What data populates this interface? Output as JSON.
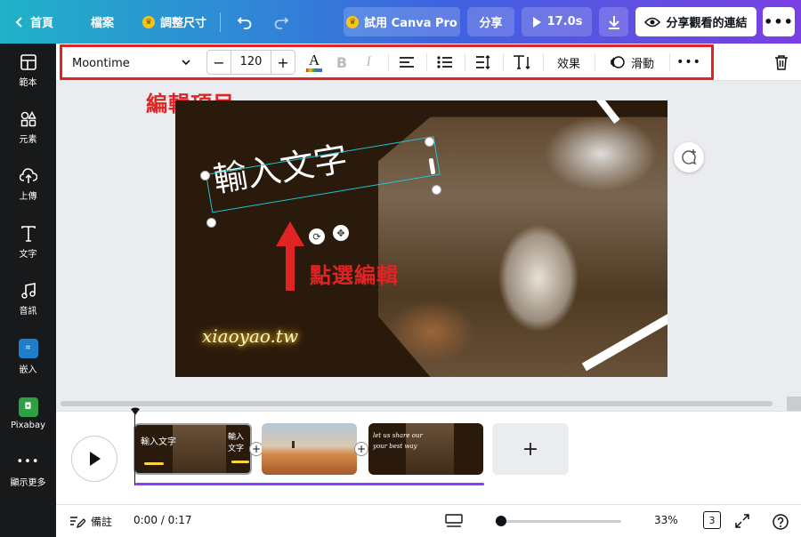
{
  "topbar": {
    "home_label": "首頁",
    "file_label": "檔案",
    "resize_label": "調整尺寸",
    "pro_label": "試用 Canva Pro",
    "share_label": "分享",
    "duration_label": "17.0s",
    "view_link_label": "分享觀看的連結",
    "gradient_start": "#1fb3c8",
    "gradient_end": "#7b3fe4"
  },
  "sidebar": {
    "items": [
      {
        "label": "範本",
        "icon": "template-icon"
      },
      {
        "label": "元素",
        "icon": "elements-icon"
      },
      {
        "label": "上傳",
        "icon": "upload-icon"
      },
      {
        "label": "文字",
        "icon": "text-icon"
      },
      {
        "label": "音訊",
        "icon": "music-icon"
      },
      {
        "label": "嵌入",
        "icon": "embed-icon"
      },
      {
        "label": "Pixabay",
        "icon": "pixabay-icon"
      },
      {
        "label": "顯示更多",
        "icon": "more-icon"
      }
    ]
  },
  "toolbar": {
    "font_name": "Moontime",
    "font_size": "120",
    "effects_label": "效果",
    "animate_label": "滑動"
  },
  "canvas": {
    "annotation_toolbar": "編輯項目",
    "annotation_click": "點選編輯",
    "slide_title": "輸入文字",
    "slide_script": "xiaoyao.tw"
  },
  "timeline": {
    "clip1_title": "輸入文字",
    "clip3_lines": [
      "let us share our",
      "your best way"
    ]
  },
  "status": {
    "notes_label": "備註",
    "time_display": "0:00 / 0:17",
    "zoom_level": "33%",
    "page_count": "3",
    "zoom_fraction": 0.05
  },
  "colors": {
    "accent_purple": "#8b3dff",
    "annotation_red": "#e02424",
    "selection_cyan": "#20c4d6"
  }
}
